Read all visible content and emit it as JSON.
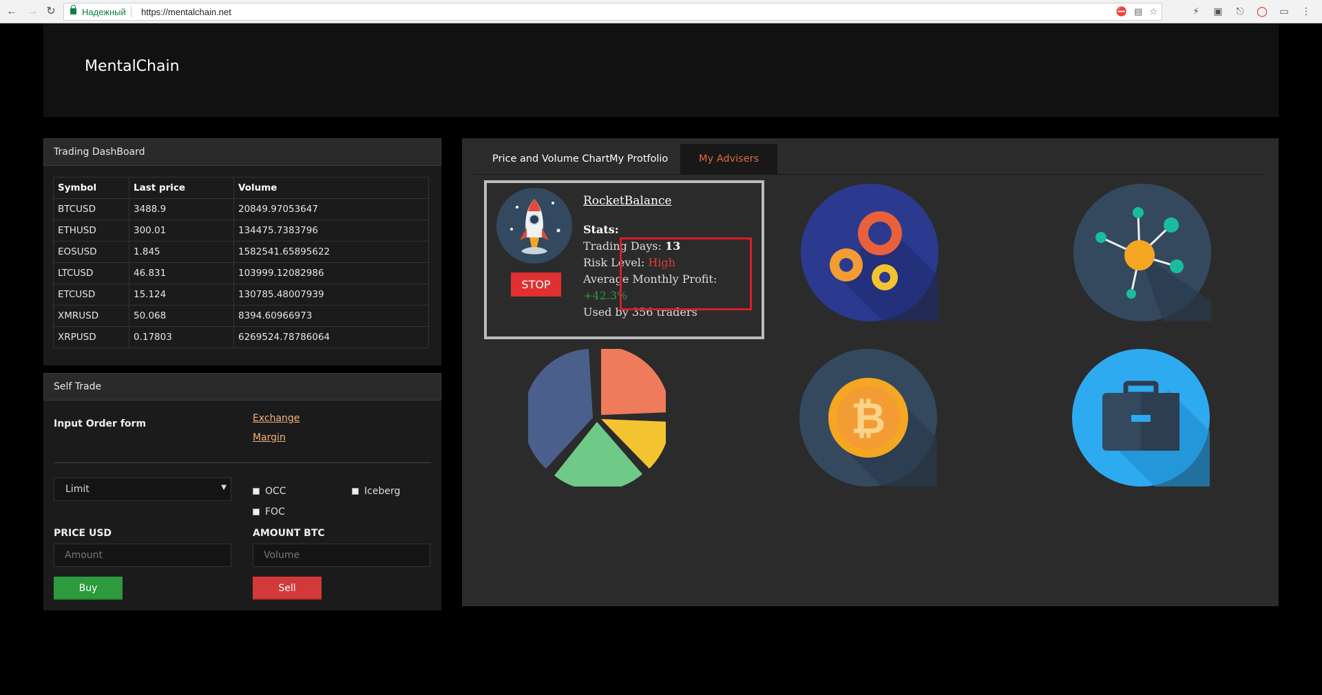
{
  "browser": {
    "secure_label": "Надежный",
    "url": "https://mentalchain.net"
  },
  "site": {
    "brand": "MentalChain"
  },
  "dashboard": {
    "title": "Trading DashBoard",
    "columns": [
      "Symbol",
      "Last price",
      "Volume"
    ],
    "rows": [
      [
        "BTCUSD",
        "3488.9",
        "20849.97053647"
      ],
      [
        "ETHUSD",
        "300.01",
        "134475.7383796"
      ],
      [
        "EOSUSD",
        "1.845",
        "1582541.65895622"
      ],
      [
        "LTCUSD",
        "46.831",
        "103999.12082986"
      ],
      [
        "ETCUSD",
        "15.124",
        "130785.48007939"
      ],
      [
        "XMRUSD",
        "50.068",
        "8394.60966973"
      ],
      [
        "XRPUSD",
        "0.17803",
        "6269524.78786064"
      ]
    ]
  },
  "self_trade": {
    "title": "Self Trade",
    "order_form_label": "Input Order form",
    "link_exchange": "Exchange",
    "link_margin": "Margin",
    "order_type": "Limit",
    "check_occ": "OCC",
    "check_iceberg": "Iceberg",
    "check_foc": "FOC",
    "price_label": "PRICE USD",
    "amount_label": "AMOUNT BTC",
    "price_placeholder": "Amount",
    "volume_placeholder": "Volume",
    "buy_label": "Buy",
    "sell_label": "Sell"
  },
  "tabs": {
    "chart": "Price and Volume Chart",
    "portfolio": "My Protfolio",
    "advisers": "My Advisers"
  },
  "adviser": {
    "name": "RocketBalance",
    "stop_label": "STOP",
    "stats_title": "Stats:",
    "trading_days_label": "Trading Days:",
    "trading_days": "13",
    "risk_label": "Risk Level:",
    "risk_value": "High",
    "profit_label": "Average Monthly Profit:",
    "profit_value": "+42.3%",
    "used_by": "Used by 356 traders"
  },
  "adviser_icons": [
    "gears-icon",
    "network-icon",
    "pie-chart-icon",
    "bitcoin-icon",
    "briefcase-icon"
  ],
  "colors": {
    "accent": "#e06a3c",
    "buy": "#2e9a3e",
    "sell": "#d23a3a",
    "highlight": "#d81e2a"
  }
}
